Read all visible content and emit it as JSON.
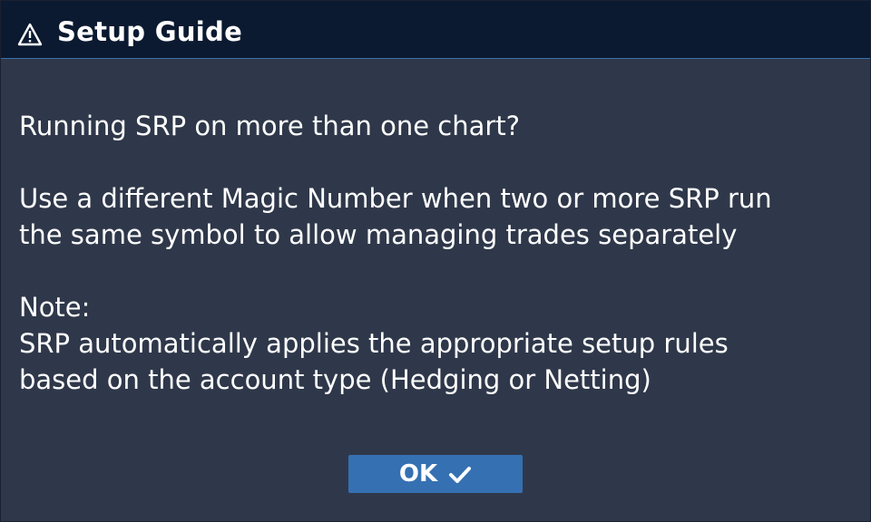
{
  "dialog": {
    "title": "Setup Guide",
    "title_icon": "warning-triangle-icon",
    "question": "Running SRP on more than one chart?",
    "advice_line1": "Use a different Magic Number when two or more SRP run",
    "advice_line2": "the same symbol to allow managing trades separately",
    "note_label": "Note:",
    "note_line1": "SRP automatically applies the appropriate setup rules",
    "note_line2": "based on the account type (Hedging or Netting)",
    "ok_label": "OK",
    "ok_icon": "checkmark-icon"
  },
  "colors": {
    "titlebar_bg": "#0b1a30",
    "body_bg": "#2f384a",
    "button_bg": "#3570b2",
    "text": "#ffffff"
  }
}
